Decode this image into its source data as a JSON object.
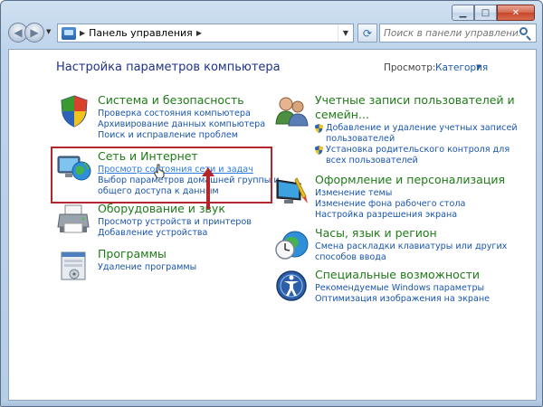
{
  "window": {
    "caption_buttons": [
      "minimize",
      "maximize",
      "close"
    ]
  },
  "nav": {
    "address_text": "Панель управления",
    "search_placeholder": "Поиск в панели управления"
  },
  "content": {
    "page_title": "Настройка параметров компьютера",
    "view_by_label": "Просмотр:",
    "view_by_value": "Категория"
  },
  "categories": {
    "system": {
      "title": "Система и безопасность",
      "icon": "shield-icon",
      "links": [
        "Проверка состояния компьютера",
        "Архивирование данных компьютера",
        "Поиск и исправление проблем"
      ]
    },
    "network": {
      "title": "Сеть и Интернет",
      "icon": "network-globe-icon",
      "links": [
        "Просмотр состояния сети и задач",
        "Выбор параметров домашней группы и",
        "общего доступа к данным"
      ]
    },
    "hardware": {
      "title": "Оборудование и звук",
      "icon": "printer-icon",
      "links": [
        "Просмотр устройств и принтеров",
        "Добавление устройства"
      ]
    },
    "programs": {
      "title": "Программы",
      "icon": "programs-icon",
      "links": [
        "Удаление программы"
      ]
    },
    "accounts": {
      "title_line1": "Учетные записи пользователей и",
      "title_line2": "семейн...",
      "icon": "users-icon",
      "links": [
        "Добавление и удаление учетных записей",
        "пользователей",
        "Установка родительского контроля для",
        "всех пользователей"
      ]
    },
    "appearance": {
      "title": "Оформление и персонализация",
      "icon": "monitor-brush-icon",
      "links": [
        "Изменение темы",
        "Изменение фона рабочего стола",
        "Настройка разрешения экрана"
      ]
    },
    "clock": {
      "title": "Часы, язык и регион",
      "icon": "clock-globe-icon",
      "links": [
        "Смена раскладки клавиатуры или других",
        "способов ввода"
      ]
    },
    "access": {
      "title": "Специальные возможности",
      "icon": "accessibility-icon",
      "links": [
        "Рекомендуемые Windows параметры",
        "Оптимизация изображения на экране"
      ]
    }
  },
  "colors": {
    "category_title": "#1e7b17",
    "link": "#1a55ad",
    "highlight": "#b3262b"
  }
}
